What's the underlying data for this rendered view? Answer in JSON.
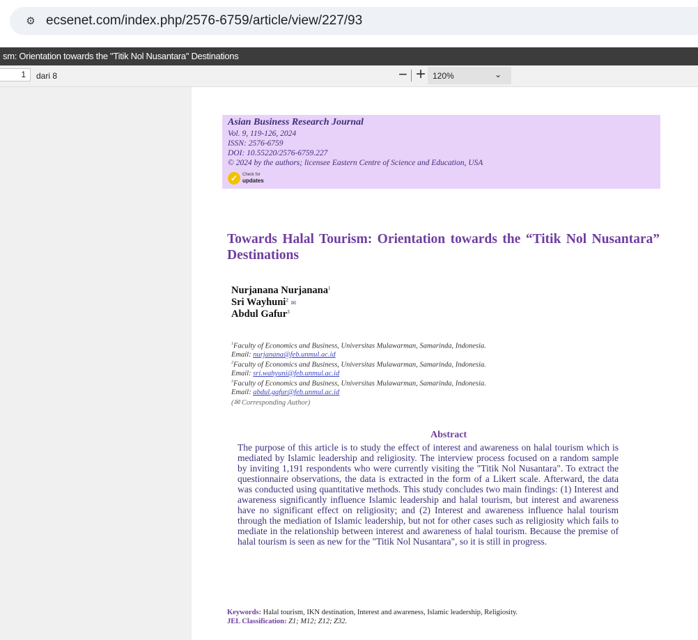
{
  "browser": {
    "url": "ecsenet.com/index.php/2576-6759/article/view/227/93",
    "site_info_icon": "tune-icon"
  },
  "viewer": {
    "title": "sm: Orientation towards the \"Titik Nol Nusantara\" Destinations",
    "page_number": "1",
    "page_total": "dari 8",
    "zoom_minus": "−",
    "zoom_plus": "+",
    "zoom_value": "120%",
    "zoom_chevron": "⌄"
  },
  "document": {
    "header": {
      "journal": "Asian Business Research Journal",
      "volume": "Vol. 9, 119-126, 2024",
      "issn": "ISSN: 2576-6759",
      "doi": "DOI: 10.55220/2576-6759.227",
      "license": "© 2024 by the authors; licensee Eastern Centre of Science and Education, USA",
      "check_line1": "Check for",
      "check_line2": "updates",
      "check_mark": "✓"
    },
    "title": "Towards Halal Tourism: Orientation towards the “Titik Nol Nusantara” Destinations",
    "authors": [
      {
        "name": "Nurjanana Nurjanana",
        "sup": "1"
      },
      {
        "name": "Sri Wayhuni",
        "sup": "2",
        "mark": "✉"
      },
      {
        "name": "Abdul Gafur",
        "sup": "3"
      }
    ],
    "affiliations": [
      {
        "sup": "1",
        "text": "Faculty of Economics and Business, Universitas Mulawarman, Samarinda, Indonesia.",
        "email_label": "Email: ",
        "email": "nurjanana@feb.unmul.ac.id"
      },
      {
        "sup": "2",
        "text": "Faculty of Economics and Business, Universitas Mulawarman, Samarinda, Indonesia.",
        "email_label": "Email: ",
        "email": "sri.wahyuni@feb.unmul.ac.id"
      },
      {
        "sup": "3",
        "text": "Faculty of Economics and Business, Universitas Mulawarman, Samarinda, Indonesia.",
        "email_label": "Email: ",
        "email": "abdul.gafur@feb.unmul.ac.id"
      }
    ],
    "corresponding_note": "(✉ Corresponding Author)",
    "abstract_heading": "Abstract",
    "abstract": "The purpose of this article is to study the effect of interest and awareness on halal tourism which is mediated by Islamic leadership and religiosity. The interview process focused on a random sample by inviting 1,191 respondents who were currently visiting the \"Titik Nol Nusantara\". To extract the questionnaire observations, the data is extracted in the form of a Likert scale. Afterward, the data was conducted using quantitative methods. This study concludes two main findings: (1) Interest and awareness significantly influence Islamic leadership and halal tourism, but interest and awareness have no significant effect on religiosity; and (2) Interest and awareness influence halal tourism through the mediation of Islamic leadership, but not for other cases such as religiosity which fails to mediate in the relationship between interest and awareness of halal tourism. Because the premise of halal tourism is seen as new for the \"Titik Nol Nusantara\", so it is still in progress.",
    "keywords_label": "Keywords: ",
    "keywords": "Halal tourism, IKN destination, Interest and awareness, Islamic leadership, Religiosity.",
    "jel_label": "JEL Classification: ",
    "jel": "Z1; M12; Z12; Z32."
  }
}
